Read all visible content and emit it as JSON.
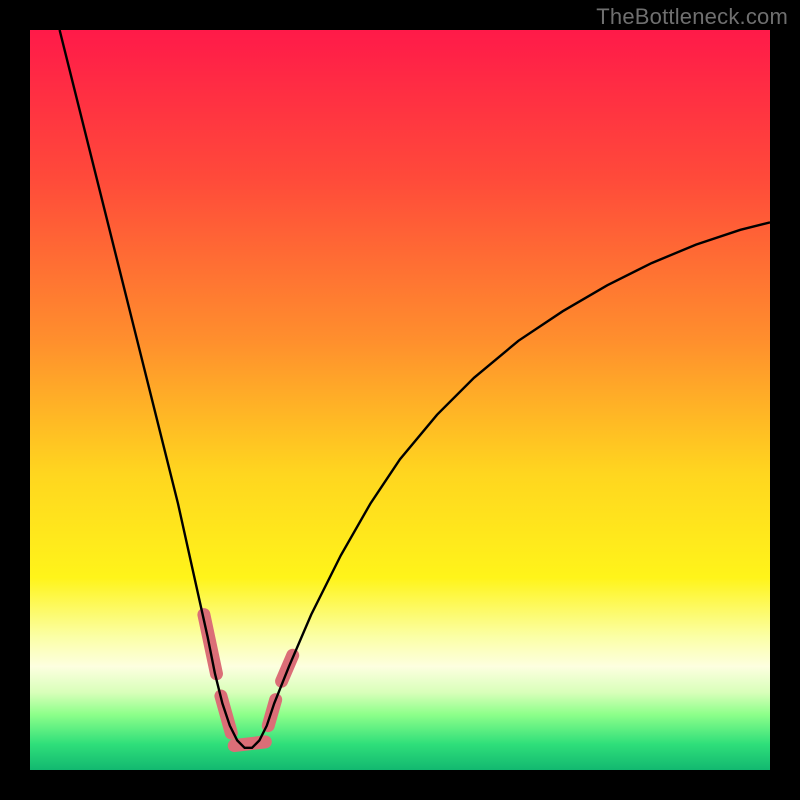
{
  "watermark": "TheBottleneck.com",
  "chart_data": {
    "type": "line",
    "title": "",
    "xlabel": "",
    "ylabel": "",
    "xlim": [
      0,
      100
    ],
    "ylim": [
      0,
      100
    ],
    "grid": false,
    "legend": false,
    "background_gradient": {
      "stops": [
        {
          "offset": 0.0,
          "color": "#ff1a49"
        },
        {
          "offset": 0.2,
          "color": "#ff4a3a"
        },
        {
          "offset": 0.42,
          "color": "#ff8f2d"
        },
        {
          "offset": 0.6,
          "color": "#ffd61f"
        },
        {
          "offset": 0.74,
          "color": "#fff41a"
        },
        {
          "offset": 0.82,
          "color": "#fbffa6"
        },
        {
          "offset": 0.86,
          "color": "#fdffe0"
        },
        {
          "offset": 0.895,
          "color": "#d9ffba"
        },
        {
          "offset": 0.925,
          "color": "#8dff8a"
        },
        {
          "offset": 0.965,
          "color": "#2fdf7a"
        },
        {
          "offset": 1.0,
          "color": "#12b870"
        }
      ]
    },
    "series": [
      {
        "name": "bottleneck-curve",
        "stroke": "#000000",
        "stroke_width": 2.4,
        "x": [
          4,
          6,
          8,
          10,
          12,
          14,
          16,
          18,
          20,
          22,
          24,
          25,
          26,
          27,
          28,
          29,
          30,
          31,
          32,
          33,
          35,
          38,
          42,
          46,
          50,
          55,
          60,
          66,
          72,
          78,
          84,
          90,
          96,
          100
        ],
        "y": [
          100,
          92,
          84,
          76,
          68,
          60,
          52,
          44,
          36,
          27,
          18,
          13,
          9,
          6,
          4,
          3,
          3,
          4,
          6,
          9,
          14,
          21,
          29,
          36,
          42,
          48,
          53,
          58,
          62,
          65.5,
          68.5,
          71,
          73,
          74
        ]
      }
    ],
    "highlight_segments": {
      "stroke": "#db6e77",
      "stroke_width": 13,
      "segments": [
        {
          "x": [
            23.5,
            25.2
          ],
          "y": [
            21,
            13
          ]
        },
        {
          "x": [
            25.8,
            27.2
          ],
          "y": [
            10,
            5
          ]
        },
        {
          "x": [
            27.6,
            31.8
          ],
          "y": [
            3.3,
            3.8
          ]
        },
        {
          "x": [
            32.2,
            33.2
          ],
          "y": [
            6,
            9.5
          ]
        },
        {
          "x": [
            34.0,
            35.5
          ],
          "y": [
            12,
            15.5
          ]
        }
      ]
    }
  }
}
